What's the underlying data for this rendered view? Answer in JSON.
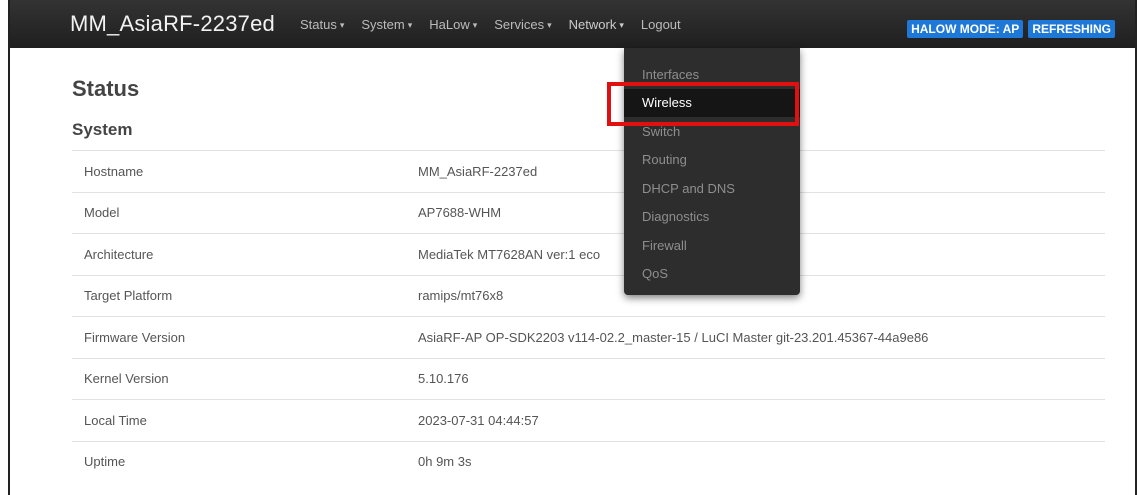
{
  "navbar": {
    "brand": "MM_AsiaRF-2237ed",
    "menu": [
      {
        "label": "Status",
        "caret": "▾"
      },
      {
        "label": "System",
        "caret": "▾"
      },
      {
        "label": "HaLow",
        "caret": "▾"
      },
      {
        "label": "Services",
        "caret": "▾"
      },
      {
        "label": "Network",
        "caret": "▾"
      },
      {
        "label": "Logout",
        "caret": ""
      }
    ],
    "badges": [
      "HALOW MODE: AP",
      "REFRESHING"
    ],
    "badge_color": "#1e78d7"
  },
  "network_dropdown": {
    "items": [
      "Interfaces",
      "Wireless",
      "Switch",
      "Routing",
      "DHCP and DNS",
      "Diagnostics",
      "Firewall",
      "QoS"
    ],
    "selected": "Wireless",
    "highlight_color": "#e01010"
  },
  "page": {
    "title": "Status",
    "section": "System"
  },
  "system_table": [
    {
      "label": "Hostname",
      "value": "MM_AsiaRF-2237ed"
    },
    {
      "label": "Model",
      "value": "AP7688-WHM"
    },
    {
      "label": "Architecture",
      "value": "MediaTek MT7628AN ver:1 eco"
    },
    {
      "label": "Target Platform",
      "value": "ramips/mt76x8"
    },
    {
      "label": "Firmware Version",
      "value": "AsiaRF-AP OP-SDK2203 v114-02.2_master-15 / LuCI Master git-23.201.45367-44a9e86"
    },
    {
      "label": "Kernel Version",
      "value": "5.10.176"
    },
    {
      "label": "Local Time",
      "value": "2023-07-31 04:44:57"
    },
    {
      "label": "Uptime",
      "value": "0h 9m 3s"
    }
  ]
}
